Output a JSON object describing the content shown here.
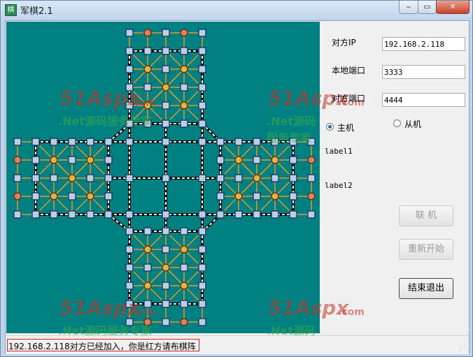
{
  "window": {
    "title": "军棋2.1",
    "icon": "army-chess-app-icon"
  },
  "controls": {
    "min_glyph": "‒",
    "max_glyph": "▭",
    "close_glyph": "✕"
  },
  "form": {
    "peer_ip_label": "对方IP",
    "peer_ip_value": "192.168.2.118",
    "local_port_label": "本地端口",
    "local_port_value": "3333",
    "peer_port_label": "对方端口",
    "peer_port_value": "4444",
    "radio_host_label": "主机",
    "radio_client_label": "从机",
    "host_selected": true,
    "label1": "label1",
    "label2": "label2"
  },
  "buttons": {
    "connect": "联  机",
    "restart": "重新开始",
    "exit": "结束退出"
  },
  "status": {
    "message": "192.168.2.118对方已经加入，你是红方请布棋阵"
  },
  "watermark": {
    "main": "51Aspx",
    "com": ".com",
    "sub": ".Net源码服务专家"
  },
  "colors": {
    "board": "#008080",
    "orange_line": "#e09a2b",
    "railway": "#000000",
    "post_fill": "#b8cfe6",
    "camp_fill": "#e0b34a",
    "hq_fill": "#d9826a"
  }
}
